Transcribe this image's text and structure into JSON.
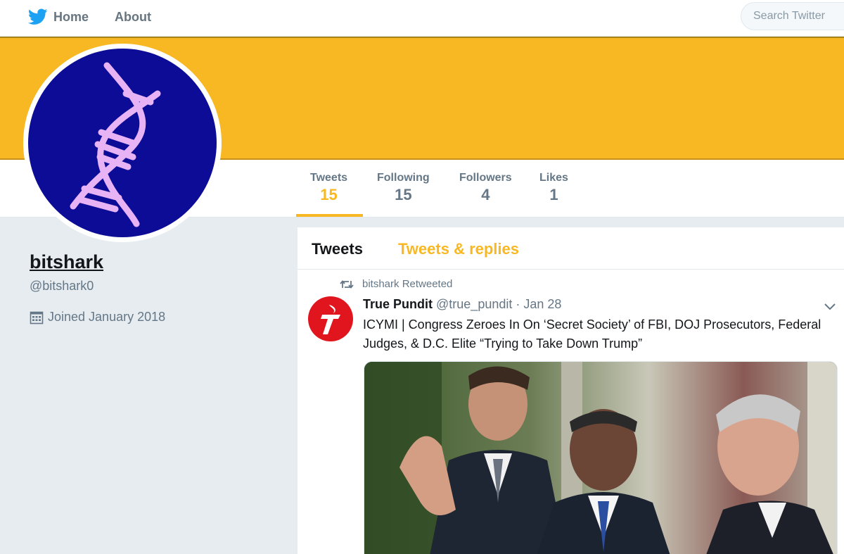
{
  "nav": {
    "home_label": "Home",
    "about_label": "About",
    "search_placeholder": "Search Twitter"
  },
  "colors": {
    "accent": "#f8b823",
    "avatar_bg": "#0c0c96",
    "dna": "#e7b3f5",
    "pundit_red": "#e1151d"
  },
  "profile": {
    "name": "bitshark",
    "handle": "@bitshark0",
    "joined": "Joined January 2018"
  },
  "stats": [
    {
      "label": "Tweets",
      "value": "15"
    },
    {
      "label": "Following",
      "value": "15"
    },
    {
      "label": "Followers",
      "value": "4"
    },
    {
      "label": "Likes",
      "value": "1"
    }
  ],
  "timeline": {
    "tabs": [
      "Tweets",
      "Tweets & replies"
    ],
    "tweet": {
      "retweet_label": "bitshark Retweeted",
      "author": "True Pundit",
      "handle": "@true_pundit",
      "dot": "·",
      "date": "Jan 28",
      "text": "ICYMI | Congress Zeroes In On ‘Secret Society’ of FBI, DOJ Prosecutors, Federal Judges, & D.C. Elite “Trying to Take Down Trump”"
    }
  }
}
